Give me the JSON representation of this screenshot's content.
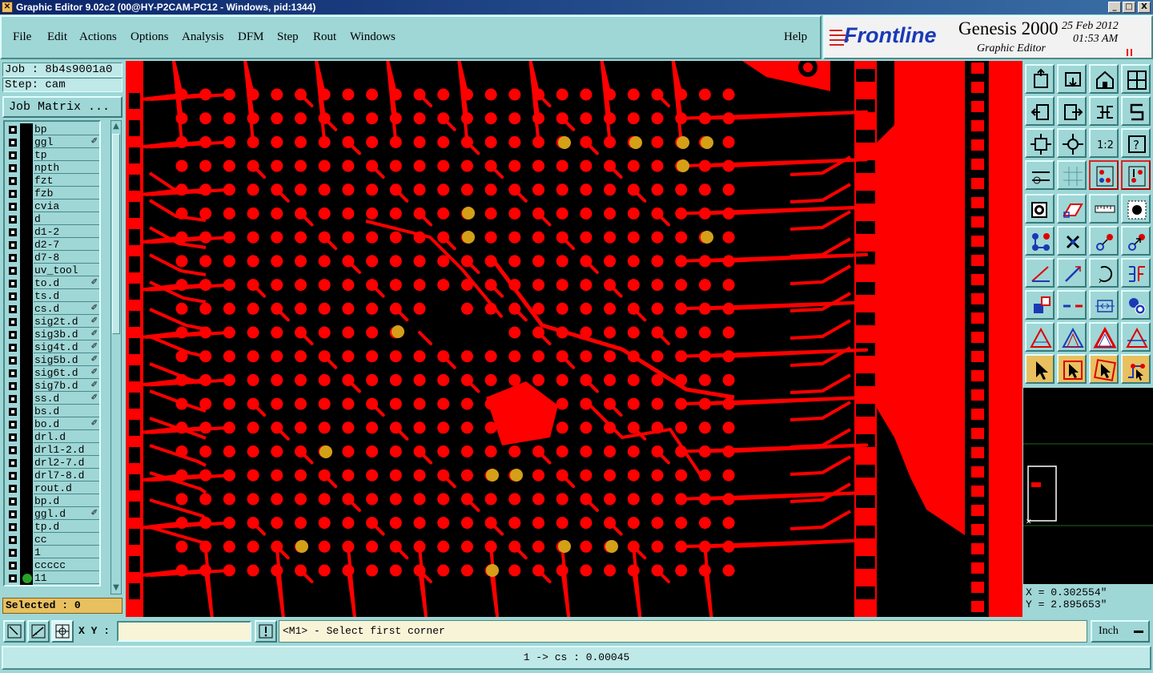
{
  "window": {
    "title": "Graphic Editor 9.02c2 (00@HY-P2CAM-PC12 - Windows, pid:1344)",
    "buttons": [
      "_",
      "□",
      "X"
    ]
  },
  "menu": [
    "File",
    "Edit",
    "Actions",
    "Options",
    "Analysis",
    "DFM",
    "Step",
    "Rout",
    "Windows"
  ],
  "help_label": "Help",
  "logo": {
    "brand": "Frontline",
    "product": "Genesis 2000",
    "subtitle": "Graphic Editor",
    "date": "25 Feb 2012",
    "time": "01:53 AM"
  },
  "job": "Job : 8b4s9001a0",
  "step": "Step: cam",
  "job_matrix_label": "Job Matrix ...",
  "layers": [
    {
      "name": "bp",
      "edit": false
    },
    {
      "name": "ggl",
      "edit": true
    },
    {
      "name": "tp",
      "edit": false
    },
    {
      "name": "npth",
      "edit": false
    },
    {
      "name": "fzt",
      "edit": false
    },
    {
      "name": "fzb",
      "edit": false
    },
    {
      "name": "cvia",
      "edit": false
    },
    {
      "name": "d",
      "edit": false
    },
    {
      "name": "d1-2",
      "edit": false
    },
    {
      "name": "d2-7",
      "edit": false
    },
    {
      "name": "d7-8",
      "edit": false
    },
    {
      "name": "uv_tool",
      "edit": false
    },
    {
      "name": "to.d",
      "edit": true
    },
    {
      "name": "ts.d",
      "edit": false
    },
    {
      "name": "cs.d",
      "edit": true
    },
    {
      "name": "sig2t.d",
      "edit": true
    },
    {
      "name": "sig3b.d",
      "edit": true
    },
    {
      "name": "sig4t.d",
      "edit": true
    },
    {
      "name": "sig5b.d",
      "edit": true
    },
    {
      "name": "sig6t.d",
      "edit": true
    },
    {
      "name": "sig7b.d",
      "edit": true
    },
    {
      "name": "ss.d",
      "edit": true
    },
    {
      "name": "bs.d",
      "edit": false
    },
    {
      "name": "bo.d",
      "edit": true
    },
    {
      "name": "drl.d",
      "edit": false
    },
    {
      "name": "drl1-2.d",
      "edit": false
    },
    {
      "name": "drl2-7.d",
      "edit": false
    },
    {
      "name": "drl7-8.d",
      "edit": false
    },
    {
      "name": "rout.d",
      "edit": false
    },
    {
      "name": "bp.d",
      "edit": false
    },
    {
      "name": "ggl.d",
      "edit": true
    },
    {
      "name": "tp.d",
      "edit": false
    },
    {
      "name": "cc",
      "edit": false
    },
    {
      "name": "1",
      "edit": false
    },
    {
      "name": "ccccc",
      "edit": false
    },
    {
      "name": "11",
      "edit": false,
      "active": true
    }
  ],
  "edit_mark": "✐",
  "selected": "Selected : 0",
  "coords": {
    "x": "X = 0.302554\"",
    "y": "Y = 2.895653\""
  },
  "xy_label": "X Y :",
  "xy_value": "",
  "prompt": "<M1> - Select first corner",
  "units": "Inch",
  "status": "1 -> cs : 0.00045",
  "colors": {
    "copper": "#ff0000",
    "drill": "#d4a017",
    "background": "#000000",
    "panel": "#9fd6d6"
  },
  "tool_icons": [
    "zoom-home-icon",
    "zoom-in-icon",
    "home-icon",
    "window-icon",
    "pan-left-icon",
    "pan-right-icon",
    "swap-icon",
    "snap-icon",
    "fit-icon",
    "center-icon",
    "ratio-1-2-icon",
    "help-icon",
    "tools-icon",
    "grid-icon",
    "layers-icon",
    "layers-alt-icon",
    "add-pad-icon",
    "add-shape-icon",
    "ruler-icon",
    "pad-icon",
    "connect-icon",
    "delete-icon",
    "move-icon",
    "copy-icon",
    "line-icon",
    "line-alt-icon",
    "arc-icon",
    "text-icon",
    "snap-pad-icon",
    "cut-icon",
    "measure-icon",
    "multi-pad-icon",
    "triangle-icon",
    "triangle-alt-icon",
    "triangle-filled-icon",
    "triangle-cross-icon",
    "pointer-icon",
    "select-box-icon",
    "select-rotate-icon",
    "route-icon"
  ]
}
